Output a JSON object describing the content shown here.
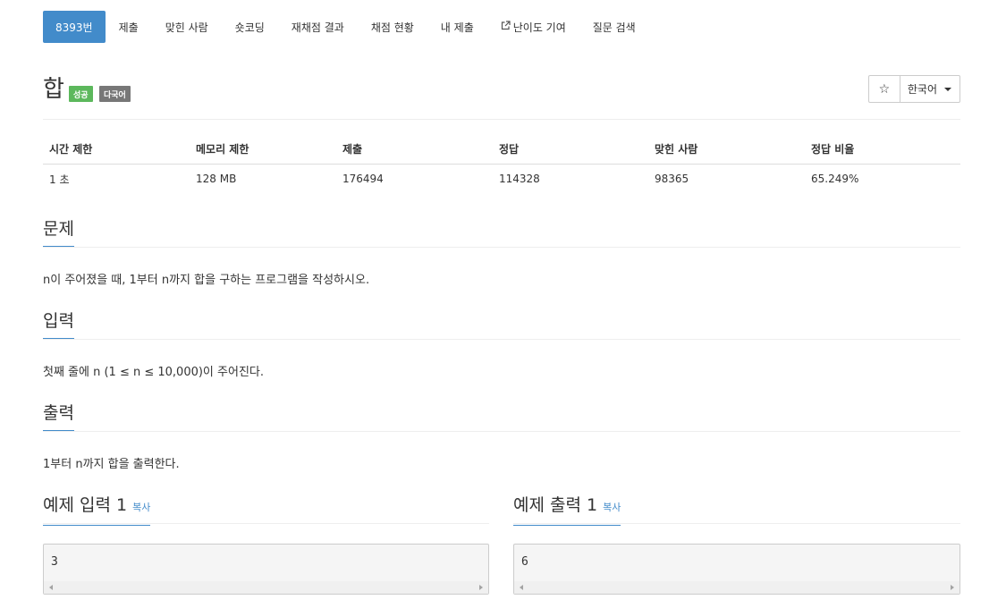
{
  "nav": {
    "tabs": [
      {
        "label": "8393번"
      },
      {
        "label": "제출"
      },
      {
        "label": "맞힌 사람"
      },
      {
        "label": "숏코딩"
      },
      {
        "label": "재채점 결과"
      },
      {
        "label": "채점 현황"
      },
      {
        "label": "내 제출"
      },
      {
        "label": "난이도 기여",
        "icon": "external-link-icon"
      },
      {
        "label": "질문 검색"
      }
    ],
    "active_index": 0
  },
  "problem": {
    "title": "합",
    "badges": {
      "success": "성공",
      "multilang": "다국어"
    },
    "star_icon": "☆",
    "language": "한국어"
  },
  "info": {
    "headers": [
      "시간 제한",
      "메모리 제한",
      "제출",
      "정답",
      "맞힌 사람",
      "정답 비율"
    ],
    "values": [
      "1 초",
      "128 MB",
      "176494",
      "114328",
      "98365",
      "65.249%"
    ]
  },
  "sections": {
    "problem": {
      "title": "문제",
      "text": "n이 주어졌을 때, 1부터 n까지 합을 구하는 프로그램을 작성하시오."
    },
    "input": {
      "title": "입력",
      "text": "첫째 줄에 n (1 ≤ n ≤ 10,000)이 주어진다."
    },
    "output": {
      "title": "출력",
      "text": "1부터 n까지 합을 출력한다."
    }
  },
  "samples": {
    "copy_label": "복사",
    "input": {
      "title": "예제 입력 1",
      "value": "3"
    },
    "output": {
      "title": "예제 출력 1",
      "value": "6"
    }
  },
  "colors": {
    "primary": "#428bca",
    "success": "#5cb85c",
    "muted": "#777777"
  }
}
